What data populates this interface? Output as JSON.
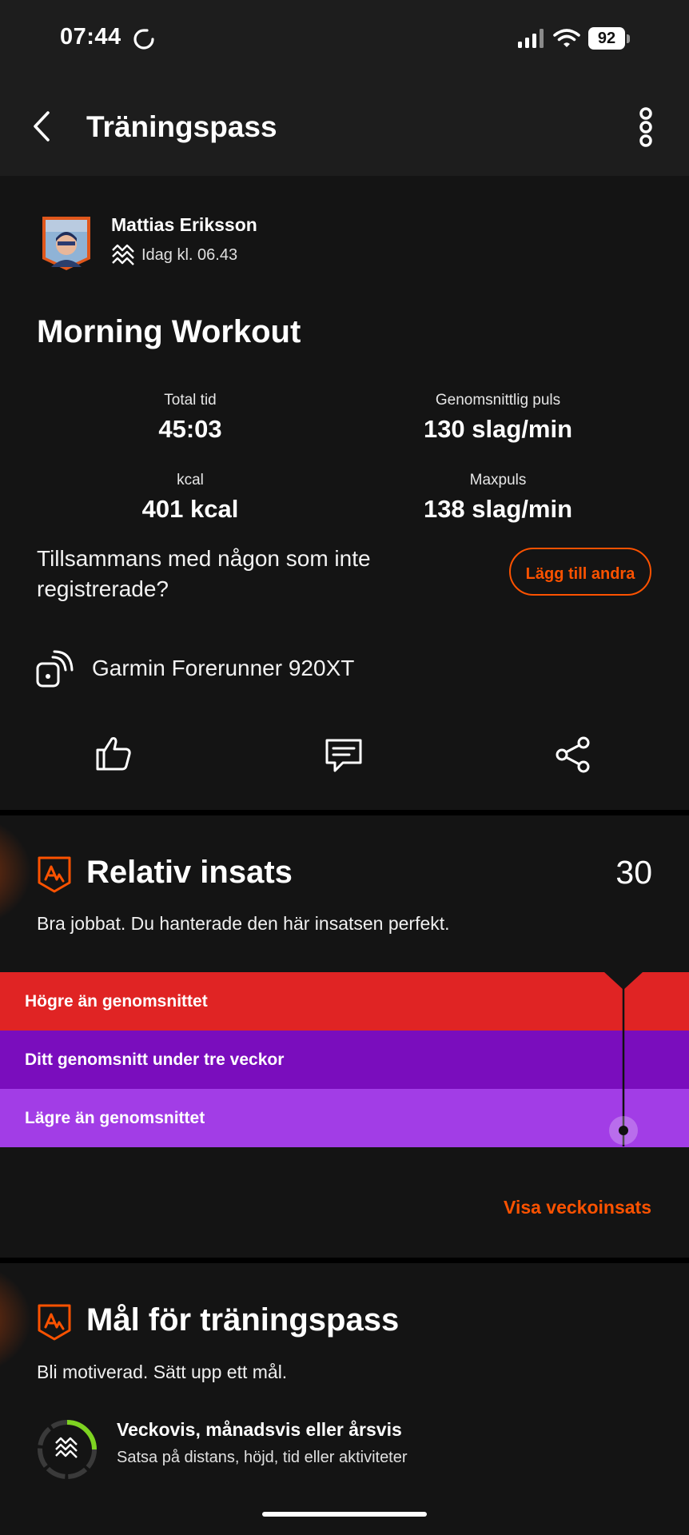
{
  "status_bar": {
    "time": "07:44",
    "battery": "92"
  },
  "header": {
    "title": "Träningspass"
  },
  "activity": {
    "athlete_name": "Mattias Eriksson",
    "timestamp": "Idag kl. 06.43",
    "title": "Morning Workout",
    "stats": [
      {
        "label": "Total tid",
        "value": "45:03"
      },
      {
        "label": "Genomsnittlig puls",
        "value": "130 slag/min"
      },
      {
        "label": "kcal",
        "value": "401 kcal"
      },
      {
        "label": "Maxpuls",
        "value": "138 slag/min"
      }
    ],
    "together_text": "Tillsammans med någon som inte registrerade?",
    "add_others_label": "Lägg till andra",
    "device": "Garmin Forerunner 920XT"
  },
  "relative_effort": {
    "title": "Relativ insats",
    "score": "30",
    "description": "Bra jobbat. Du hanterade den här insatsen perfekt.",
    "bands": [
      {
        "label": "Högre än genomsnittet",
        "color": "#e02424"
      },
      {
        "label": "Ditt genomsnitt under tre veckor",
        "color": "#7a0dbd"
      },
      {
        "label": "Lägre än genomsnittet",
        "color": "#a23de6"
      }
    ],
    "link_label": "Visa veckoinsats"
  },
  "goals": {
    "title": "Mål för träningspass",
    "description": "Bli motiverad. Sätt upp ett mål.",
    "option_title": "Veckovis, månadsvis eller årsvis",
    "option_subtitle": "Satsa på distans, höjd, tid eller aktiviteter"
  },
  "colors": {
    "accent": "#fc5200",
    "background": "#111111",
    "header": "#1d1d1d"
  }
}
